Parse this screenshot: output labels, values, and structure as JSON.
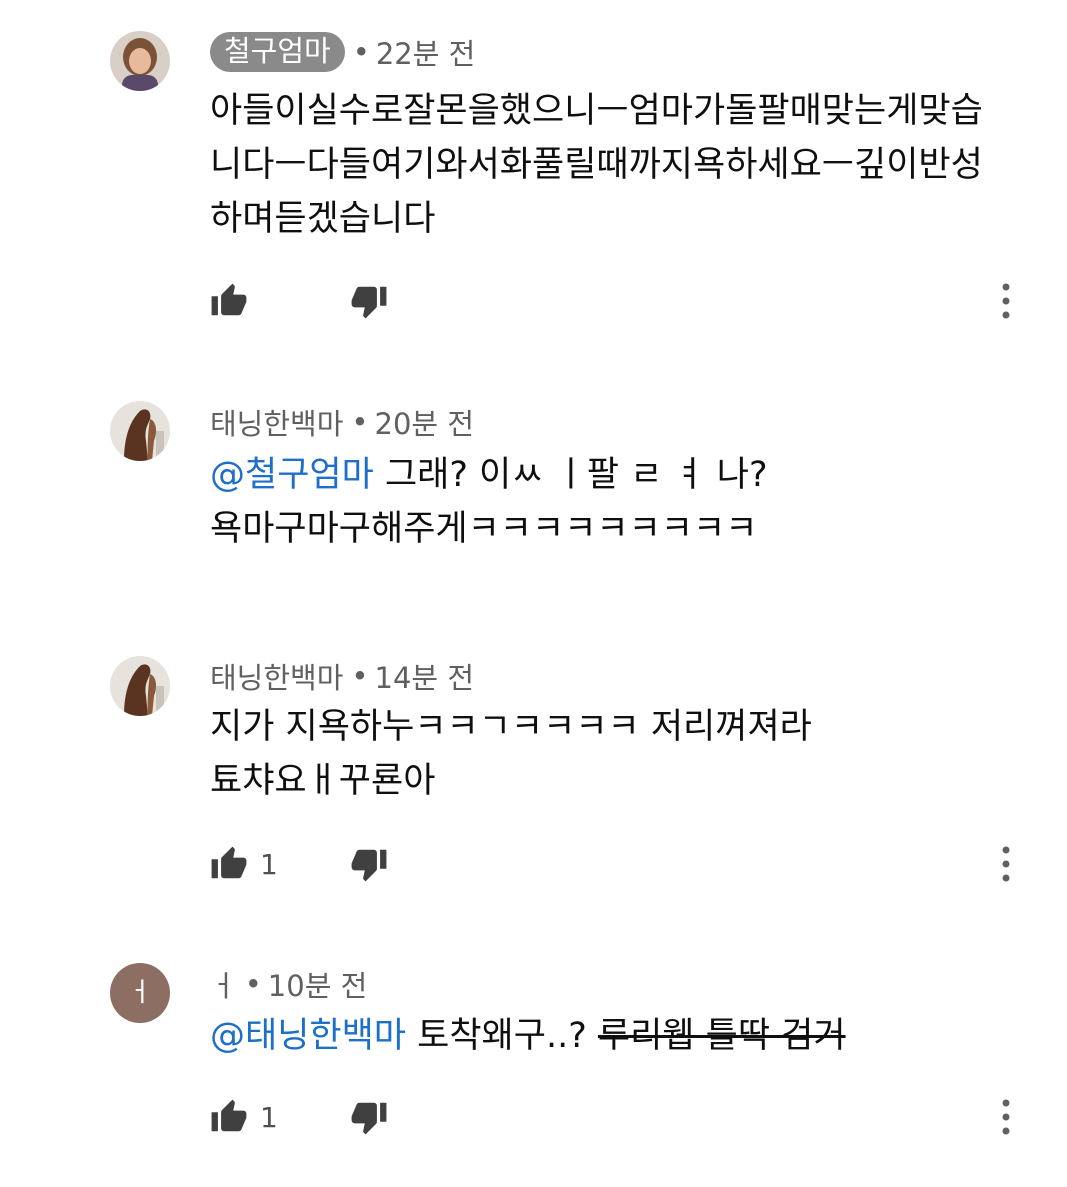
{
  "comments": [
    {
      "author": "철구엄마",
      "time": "22분 전",
      "lines": [
        "아들이실수로잘몬을했으니ㅡ엄마가돌팔매맞는게맞습",
        "니다ㅡ다들여기와서화풀릴때까지욕하세요ㅡ깊이반성",
        "하며듣겠습니다"
      ],
      "likes": ""
    },
    {
      "author": "태닝한백마",
      "time": "20분 전",
      "mention": "@철구엄마",
      "line1_rest": " 그래? 이ㅆ ㅣ팔 ㄹ ㅕ 나?",
      "line2": "욕마구마구해주게ㅋㅋㅋㅋㅋㅋㅋㅋㅋ"
    },
    {
      "author": "태닝한백마",
      "time": "14분 전",
      "lines": [
        "지가 지욕하누ㅋㅋㄱㅋㅋㅋㅋ 저리껴져라",
        "툐챠요ㅐ꾸룐아"
      ],
      "likes": "1"
    },
    {
      "author": "ㅓ",
      "avatar_letter": "ㅓ",
      "time": "10분 전",
      "mention": "@태닝한백마",
      "text": " 토착왜구..? ",
      "strike_text": "루리웹 틀딱 검거",
      "likes": "1"
    }
  ],
  "separator": "•",
  "colors": {
    "mention": "#1e6fc9",
    "meta_text": "#606060",
    "author_pill_bg": "#8a8a8a",
    "avatar_letter_bg": "#8d6e63"
  },
  "icons": [
    "thumbs-up-icon",
    "thumbs-down-icon",
    "more-vert-icon"
  ]
}
